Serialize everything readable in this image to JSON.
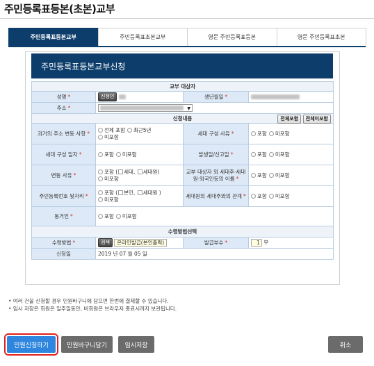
{
  "page_title": "주민등록표등본(초본)교부",
  "tabs": [
    {
      "label": "주민등록표등본교부",
      "active": true
    },
    {
      "label": "주민등록표초본교부",
      "active": false
    },
    {
      "label": "영문 주민등록표등본",
      "active": false
    },
    {
      "label": "영문 주민등록표초본",
      "active": false
    }
  ],
  "panel_title": "주민등록표등본교부신청",
  "sections": {
    "recipient": "교부 대상자",
    "content": "신청내용",
    "receive": "수령방법선택"
  },
  "fields": {
    "name": "성명",
    "name_button": "신청인",
    "birth": "생년월일",
    "address": "주소",
    "past_address": "과거의 주소 변동 사항",
    "household_reason": "세대 구성 사유",
    "household_date": "세대 구성 일자",
    "report_date": "발생일/신고일",
    "change_reason": "변동 사유",
    "foreign_names": "교부 대상자 외 세대주·세대원·외국인등의 이름",
    "resident_no_back": "주민등록번호 뒷자리",
    "relationship": "세대원의 세대주와의 관계",
    "cohabitant": "동거인",
    "receive_method": "수령방법",
    "issue_count": "발급부수",
    "apply_date": "신청일"
  },
  "content_buttons": {
    "include_all": "전체포함",
    "exclude_all": "전체미포함"
  },
  "options": {
    "include": "포함",
    "exclude": "미포함",
    "full_include": "전체 포함",
    "recent_5y": "최근5년",
    "household": "세대",
    "household_member": "세대원",
    "self": "본인"
  },
  "receive": {
    "search_button": "검색",
    "method_value": "온라인발급(본인출력)",
    "count_value": "1",
    "count_unit": "부",
    "date_value": "2019 년 07 월 05 일"
  },
  "notes": [
    "• 여러 건을 신청할 경우 민원바구니에 담으면 한번에 결제할 수 있습니다.",
    "• 임시 저장은 회원은 일주일동안, 비회원은 브라우저 종료시까지 보관됩니다."
  ],
  "buttons": {
    "submit": "민원신청하기",
    "basket": "민원바구니담기",
    "temp_save": "임시저장",
    "cancel": "취소"
  },
  "colors": {
    "navy": "#0c3d6b",
    "header_cell": "#dde9f6",
    "primary_button": "#2e86de",
    "gray_button": "#6b6b6b",
    "highlight_outline": "#e0201a"
  }
}
